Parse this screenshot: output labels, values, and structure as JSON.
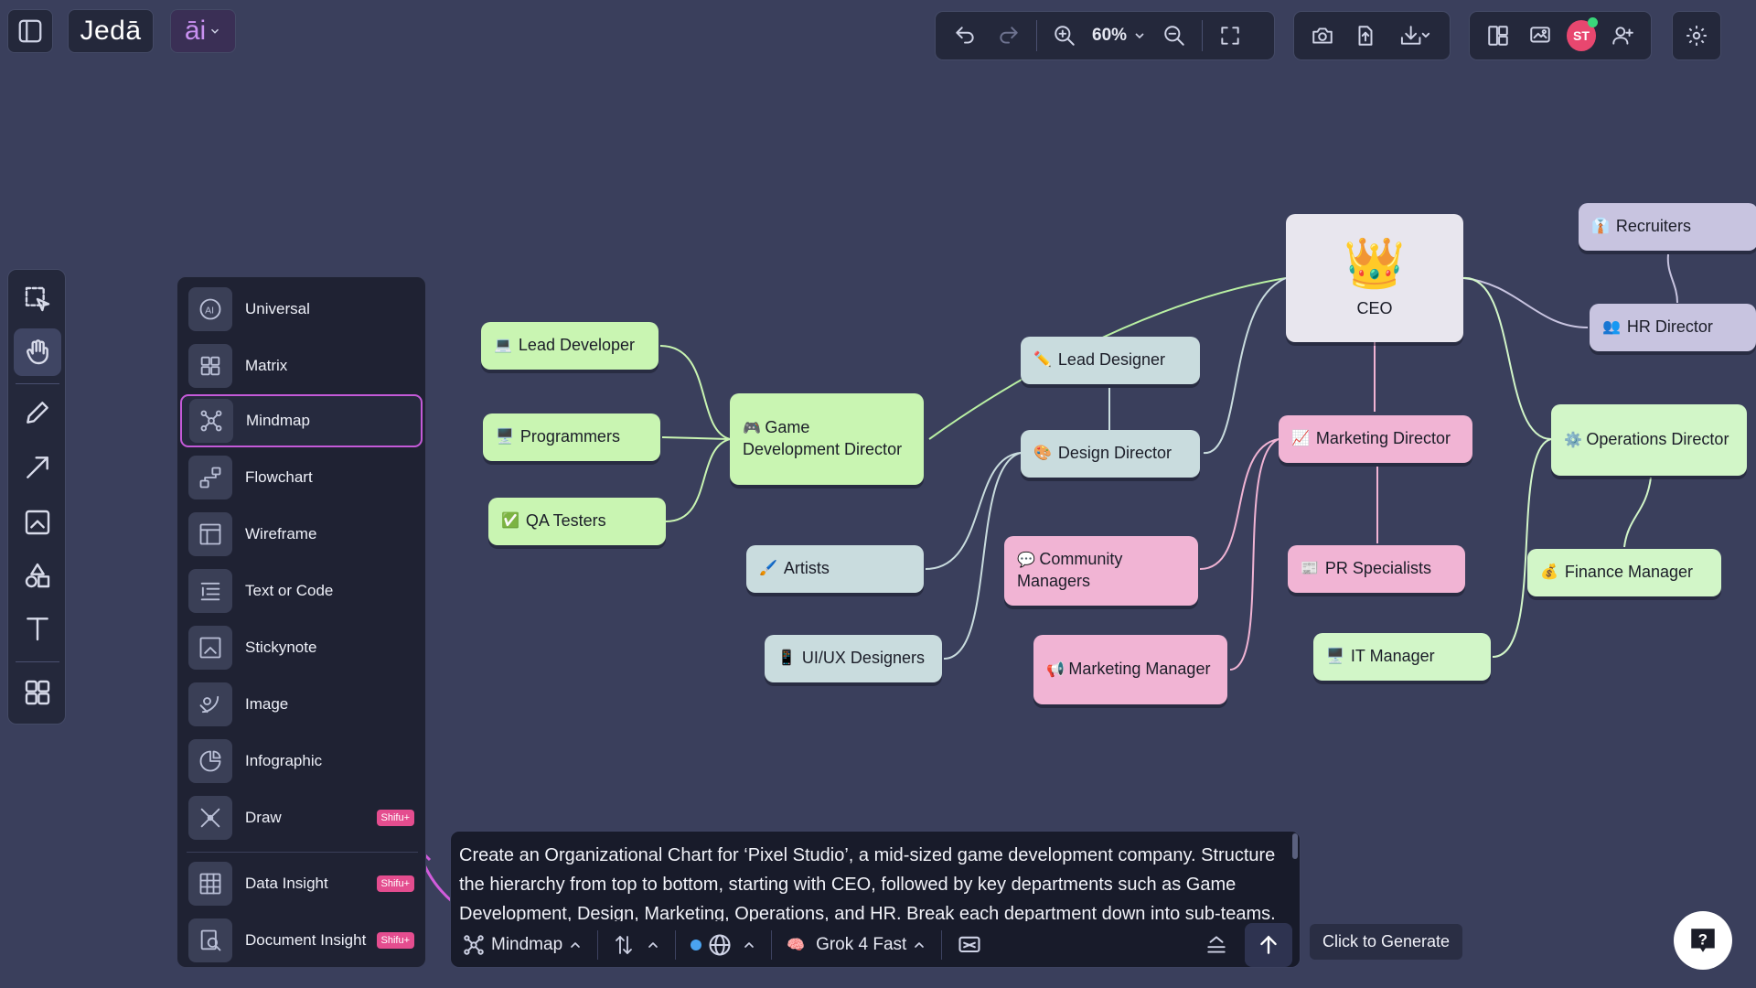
{
  "header": {
    "logo": "Jedā",
    "ai_label": "āi",
    "zoom": "60%"
  },
  "menu": {
    "items": [
      {
        "label": "Universal"
      },
      {
        "label": "Matrix"
      },
      {
        "label": "Mindmap"
      },
      {
        "label": "Flowchart"
      },
      {
        "label": "Wireframe"
      },
      {
        "label": "Text or Code"
      },
      {
        "label": "Stickynote"
      },
      {
        "label": "Image"
      },
      {
        "label": "Infographic"
      },
      {
        "label": "Draw",
        "badge": "Shifu+"
      },
      {
        "label": "Data Insight",
        "badge": "Shifu+"
      },
      {
        "label": "Document Insight",
        "badge": "Shifu+"
      }
    ]
  },
  "nodes": {
    "ceo": "CEO",
    "recruiters": "Recruiters",
    "hr_director": "HR Director",
    "lead_designer": "Lead Designer",
    "lead_developer": "Lead Developer",
    "programmers": "Programmers",
    "qa_testers": "QA Testers",
    "game_dev_director": "Game Development Director",
    "design_director": "Design Director",
    "marketing_director": "Marketing Director",
    "operations_director": "Operations Director",
    "artists": "Artists",
    "community_managers": "Community Managers",
    "pr_specialists": "PR Specialists",
    "finance_manager": "Finance Manager",
    "uiux_designers": "UI/UX Designers",
    "marketing_manager": "Marketing Manager",
    "it_manager": "IT Manager"
  },
  "prompt": {
    "text": "Create an Organizational Chart for ‘Pixel Studio’, a mid-sized game development company. Structure the hierarchy from top to bottom, starting with CEO, followed by key departments such as Game Development, Design, Marketing, Operations, and HR. Break each department down into sub-teams.",
    "mode": "Mindmap",
    "model": "Grok 4 Fast",
    "tooltip": "Click to Generate"
  },
  "colors": {
    "background": "#3a3f5c",
    "accent": "#c45ad8",
    "badge": "#e44d8f"
  }
}
